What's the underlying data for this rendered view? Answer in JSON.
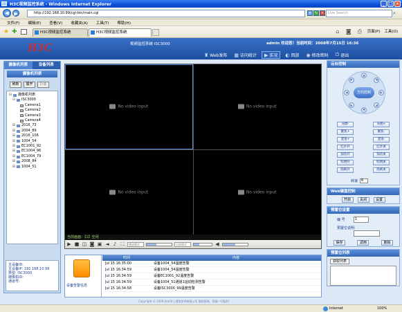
{
  "window": {
    "title": "H3C视频监控系统 - Windows Internet Explorer",
    "min": "_",
    "max": "□",
    "close": "×"
  },
  "browser": {
    "address": "http://192.168.10.99/cgi-bin/main.cgi",
    "search_placeholder": "Live Search",
    "menu": [
      "文件(F)",
      "编辑(E)",
      "查看(V)",
      "收藏夹(A)",
      "工具(T)",
      "帮助(H)"
    ],
    "tabs": [
      "H3C视频监控系统",
      "H3C视频监控系统"
    ],
    "tools": {
      "page": "页面(P)",
      "tools": "工具(O)"
    },
    "status_zone": "Internet",
    "zoom": "100%"
  },
  "header": {
    "logo": "H3C",
    "system_name": "视频监控系统 ISC3000",
    "welcome": "admin 欢迎您！当前时间：2008年7月15日 16:36",
    "nav": [
      {
        "label": "Web发布",
        "icon": "♜"
      },
      {
        "label": "访问统计",
        "icon": "▦"
      },
      {
        "label": "实况",
        "icon": "▶"
      },
      {
        "label": "回放",
        "icon": "◐"
      },
      {
        "label": "修改密码",
        "icon": "◉"
      },
      {
        "label": "退出",
        "icon": "⏻"
      }
    ]
  },
  "left": {
    "tabs": [
      "摄像机列表",
      "设备列表"
    ],
    "title": "摄像机列表",
    "buttons": [
      "刷新",
      "展开",
      "折叠"
    ],
    "tree": [
      {
        "label": "摄像机列表",
        "level": 0,
        "exp": "⊟",
        "type": "folder"
      },
      {
        "label": "ISC3000",
        "level": 1,
        "exp": "⊟",
        "type": "folder"
      },
      {
        "label": "Camera1",
        "level": 2,
        "exp": "",
        "type": "cam"
      },
      {
        "label": "Camera2",
        "level": 2,
        "exp": "",
        "type": "cam"
      },
      {
        "label": "Camera3",
        "level": 2,
        "exp": "",
        "type": "cam"
      },
      {
        "label": "Camera4",
        "level": 2,
        "exp": "",
        "type": "cam"
      },
      {
        "label": "2016_73",
        "level": 1,
        "exp": "⊞",
        "type": "folder"
      },
      {
        "label": "2004_89",
        "level": 1,
        "exp": "⊞",
        "type": "folder"
      },
      {
        "label": "2016_106",
        "level": 1,
        "exp": "⊞",
        "type": "folder"
      },
      {
        "label": "1004_54",
        "level": 1,
        "exp": "⊞",
        "type": "folder"
      },
      {
        "label": "EC1001_92",
        "level": 1,
        "exp": "⊞",
        "type": "folder"
      },
      {
        "label": "EC1004_96",
        "level": 1,
        "exp": "⊞",
        "type": "folder"
      },
      {
        "label": "EC1004_79",
        "level": 1,
        "exp": "⊞",
        "type": "folder"
      },
      {
        "label": "2008_84",
        "level": 1,
        "exp": "⊞",
        "type": "folder"
      },
      {
        "label": "1004_51",
        "level": 1,
        "exp": "⊞",
        "type": "folder"
      }
    ],
    "info": [
      "主设备ID:",
      "主设备IP: 192.168.10.99",
      "类型: ISC3000",
      "摄像机ID:",
      "通道号:"
    ]
  },
  "video": {
    "no_video": "No video input",
    "status": "当前画面：【1】空闲",
    "selectors": [
      "播放模式",
      "分屏模式"
    ],
    "volume_level": 0.5
  },
  "alarm": {
    "label": "设备告警信息",
    "columns": [
      "时间",
      "内容"
    ],
    "rows": [
      {
        "time": "Jul 15 16:35:00",
        "content": "设备1004_54温度告警"
      },
      {
        "time": "Jul 15 16:34:59",
        "content": "设备1004_54温度告警"
      },
      {
        "time": "Jul 15 16:34:59",
        "content": "设备EC1001_92温度告警"
      },
      {
        "time": "Jul 15 16:34:59",
        "content": "设备1004_51通道1运动检测告警"
      },
      {
        "time": "Jul 15 16:34:58",
        "content": "设备ISC3000_99温度告警"
      }
    ]
  },
  "ptz": {
    "title": "云台控制",
    "center": "方向控制",
    "rows": [
      [
        "光圈-",
        "光圈+"
      ],
      [
        "聚焦+",
        "聚焦-"
      ],
      [
        "变倍+",
        "变倍-"
      ],
      [
        "红外开",
        "红外关"
      ],
      [
        "加热开",
        "加热关"
      ],
      [
        "照明开",
        "照明关"
      ],
      [
        "雨刷开",
        "雨刷关"
      ]
    ],
    "speed_label": "转速",
    "speed_value": "6"
  },
  "keyboard": {
    "title": "Web键盘控制",
    "buttons": [
      "开启",
      "关闭",
      "设置"
    ]
  },
  "preset": {
    "title": "预置位设置",
    "number_label": "编 号",
    "number_value": "1",
    "desc_label": "预置位说明:",
    "buttons": [
      "保存",
      "调用",
      "删除"
    ]
  },
  "preset_list": {
    "title": "预置位列表",
    "button": "获取列表"
  },
  "footer": {
    "copyright": "Copyright © 2008 杭州华三通信技术有限公司 版权所有，保留一切权利"
  }
}
